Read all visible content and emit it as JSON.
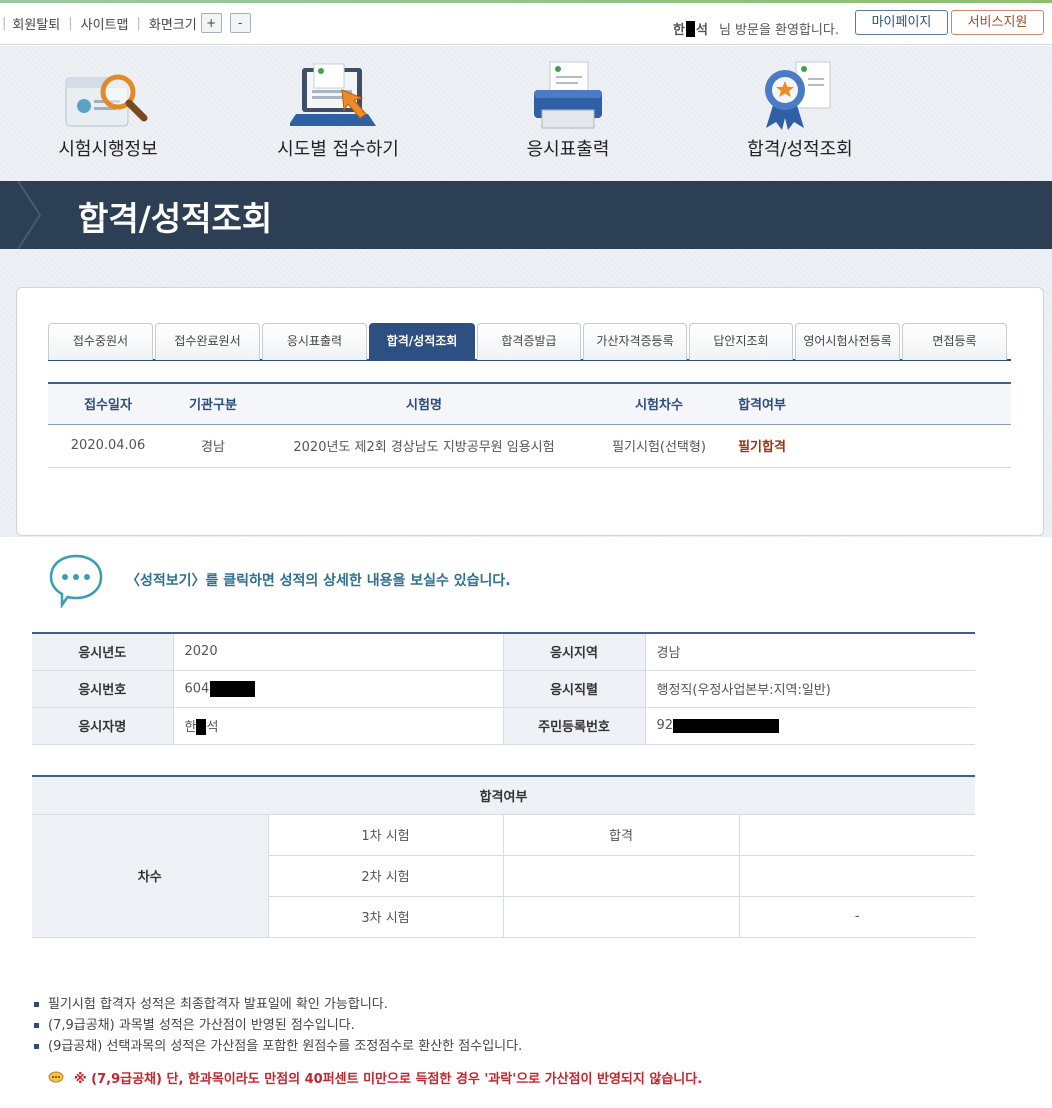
{
  "top_bar": {
    "links": [
      "회원탈퇴",
      "사이트맵"
    ],
    "zoom_label": "화면크기",
    "zoom_in": "+",
    "zoom_out": "-",
    "welcome_name_first": "한",
    "welcome_name_last": "석",
    "welcome_suffix": "님 방문을 환영합니다.",
    "mypage_button": "마이페이지",
    "service_button": "서비스지원"
  },
  "icon_menu": [
    {
      "label": "시험시행정보",
      "icon": "search-document-icon"
    },
    {
      "label": "시도별 접수하기",
      "icon": "laptop-apply-icon"
    },
    {
      "label": "응시표출력",
      "icon": "printer-icon"
    },
    {
      "label": "합격/성적조회",
      "icon": "award-ribbon-icon"
    }
  ],
  "page_title": "합격/성적조회",
  "tabs": [
    "접수중원서",
    "접수완료원서",
    "응시표출력",
    "합격/성적조회",
    "합격증발급",
    "가산자격증등록",
    "답안지조회",
    "영어시험사전등록",
    "면접등록"
  ],
  "active_tab": "합격/성적조회",
  "application_table": {
    "headers": [
      "접수일자",
      "기관구분",
      "시험명",
      "시험차수",
      "합격여부"
    ],
    "rows": [
      {
        "date": "2020.04.06",
        "agency": "경남",
        "exam": "2020년도 제2회 경상남도 지방공무원 임용시험",
        "round": "필기시험(선택형)",
        "result": "필기합격"
      }
    ]
  },
  "notice": "〈성적보기〉를 클릭하면 성적의 상세한 내용을 보실수 있습니다.",
  "info": {
    "year_label": "응시년도",
    "year": "2020",
    "region_label": "응시지역",
    "region": "경남",
    "number_label": "응시번호",
    "number_prefix": "604",
    "job_label": "응시직렬",
    "job": "행정직(우정사업본부:지역:일반)",
    "name_label": "응시자명",
    "name_first": "한",
    "name_last": "석",
    "rrn_label": "주민등록번호",
    "rrn_prefix": "92"
  },
  "result_table": {
    "header": "합격여부",
    "row_header": "차수",
    "rows": [
      {
        "round": "1차 시험",
        "col2": "합격",
        "col3": ""
      },
      {
        "round": "2차 시험",
        "col2": "",
        "col3": ""
      },
      {
        "round": "3차 시험",
        "col2": "",
        "col3": "-"
      }
    ]
  },
  "notes": [
    "필기시험 합격자 성적은 최종합격자 발표일에 확인 가능합니다.",
    "(7,9급공채) 과목별 성적은 가산점이 반영된 점수입니다.",
    "(9급공채) 선택과목의 성적은 가산점을 포함한 원점수를 조정점수로 환산한 점수입니다."
  ],
  "warning": "※ (7,9급공채) 단, 한과목이라도 만점의 40퍼센트 미만으로 득점한 경우 '과락'으로 가산점이 반영되지 않습니다.",
  "colors": {
    "banner": "#2d3f54",
    "tab_active": "#2d4f82",
    "header_text": "#2b4d7e",
    "pass_text": "#9a3412",
    "warning": "#c0262d"
  }
}
